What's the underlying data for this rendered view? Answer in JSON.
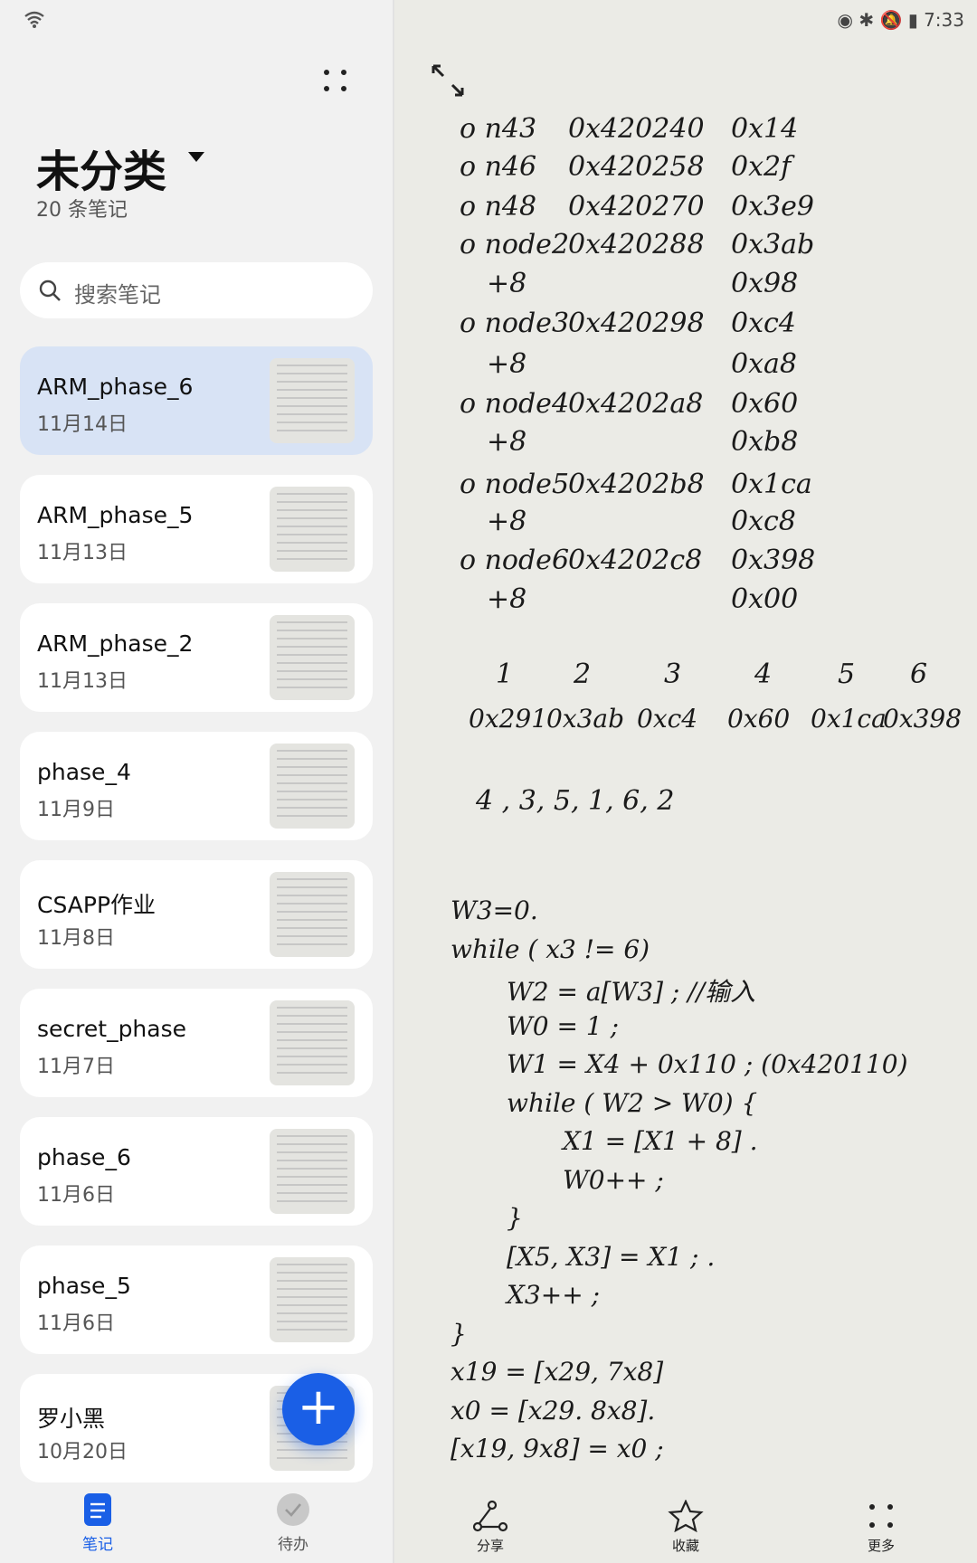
{
  "status": {
    "time": "7:33"
  },
  "sidebar": {
    "title": "未分类",
    "count": "20 条笔记",
    "search_placeholder": "搜索笔记",
    "notes": [
      {
        "title": "ARM_phase_6",
        "date": "11月14日",
        "selected": true
      },
      {
        "title": "ARM_phase_5",
        "date": "11月13日"
      },
      {
        "title": "ARM_phase_2",
        "date": "11月13日"
      },
      {
        "title": "phase_4",
        "date": "11月9日"
      },
      {
        "title": "CSAPP作业",
        "date": "11月8日"
      },
      {
        "title": "secret_phase",
        "date": "11月7日"
      },
      {
        "title": "phase_6",
        "date": "11月6日"
      },
      {
        "title": "phase_5",
        "date": "11月6日"
      },
      {
        "title": "罗小黑",
        "date": "10月20日"
      }
    ],
    "nav": [
      {
        "label": "笔记",
        "icon": "notes-icon",
        "active": true
      },
      {
        "label": "待办",
        "icon": "todo-check-icon"
      }
    ]
  },
  "accent": "#1a5fe6",
  "note": {
    "table": [
      [
        "o n43",
        "0x420240",
        "0x14"
      ],
      [
        "o n46",
        "0x420258",
        "0x2f"
      ],
      [
        "o n48",
        "0x420270",
        "0x3e9"
      ],
      [
        "o node2",
        "0x420288",
        "0x3ab"
      ],
      [
        "+8",
        "",
        "0x98"
      ],
      [
        "o node3",
        "0x420298",
        "0xc4"
      ],
      [
        "+8",
        "",
        "0xa8"
      ],
      [
        "o node4",
        "0x4202a8",
        "0x60"
      ],
      [
        "+8",
        "",
        "0xb8"
      ],
      [
        "o node5",
        "0x4202b8",
        "0x1ca"
      ],
      [
        "+8",
        "",
        "0xc8"
      ],
      [
        "o node6",
        "0x4202c8",
        "0x398"
      ],
      [
        "+8",
        "",
        "0x00"
      ]
    ],
    "indices": [
      "1",
      "2",
      "3",
      "4",
      "5",
      "6"
    ],
    "values": [
      "0x291",
      "0x3ab",
      "0xc4",
      "0x60",
      "0x1ca",
      "0x398"
    ],
    "order": "4 , 3, 5, 1, 6, 2",
    "code": [
      {
        "text": "W3=0.",
        "indent": 0
      },
      {
        "text": "while ( x3 != 6)",
        "indent": 0
      },
      {
        "text": "W2 = a[W3] ;  //输入",
        "indent": 1
      },
      {
        "text": "W0 = 1 ;",
        "indent": 1
      },
      {
        "text": "W1 = X4 + 0x110 ; (0x420110)",
        "indent": 1
      },
      {
        "text": "while ( W2 > W0) {",
        "indent": 1
      },
      {
        "text": "X1 = [X1 + 8] .",
        "indent": 2
      },
      {
        "text": "W0++ ;",
        "indent": 2
      },
      {
        "text": "}",
        "indent": 1
      },
      {
        "text": "[X5, X3] = X1 ; .",
        "indent": 1
      },
      {
        "text": "X3++ ;",
        "indent": 1
      },
      {
        "text": "}",
        "indent": 0
      },
      {
        "text": "x19 = [x29, 7x8]",
        "indent": 0
      },
      {
        "text": "x0 = [x29. 8x8].",
        "indent": 0
      },
      {
        "text": "[x19, 9x8] = x0 ;",
        "indent": 0
      }
    ]
  },
  "toolbar": [
    {
      "label": "分享",
      "icon": "share-icon"
    },
    {
      "label": "收藏",
      "icon": "star-icon"
    },
    {
      "label": "更多",
      "icon": "more-icon"
    }
  ]
}
